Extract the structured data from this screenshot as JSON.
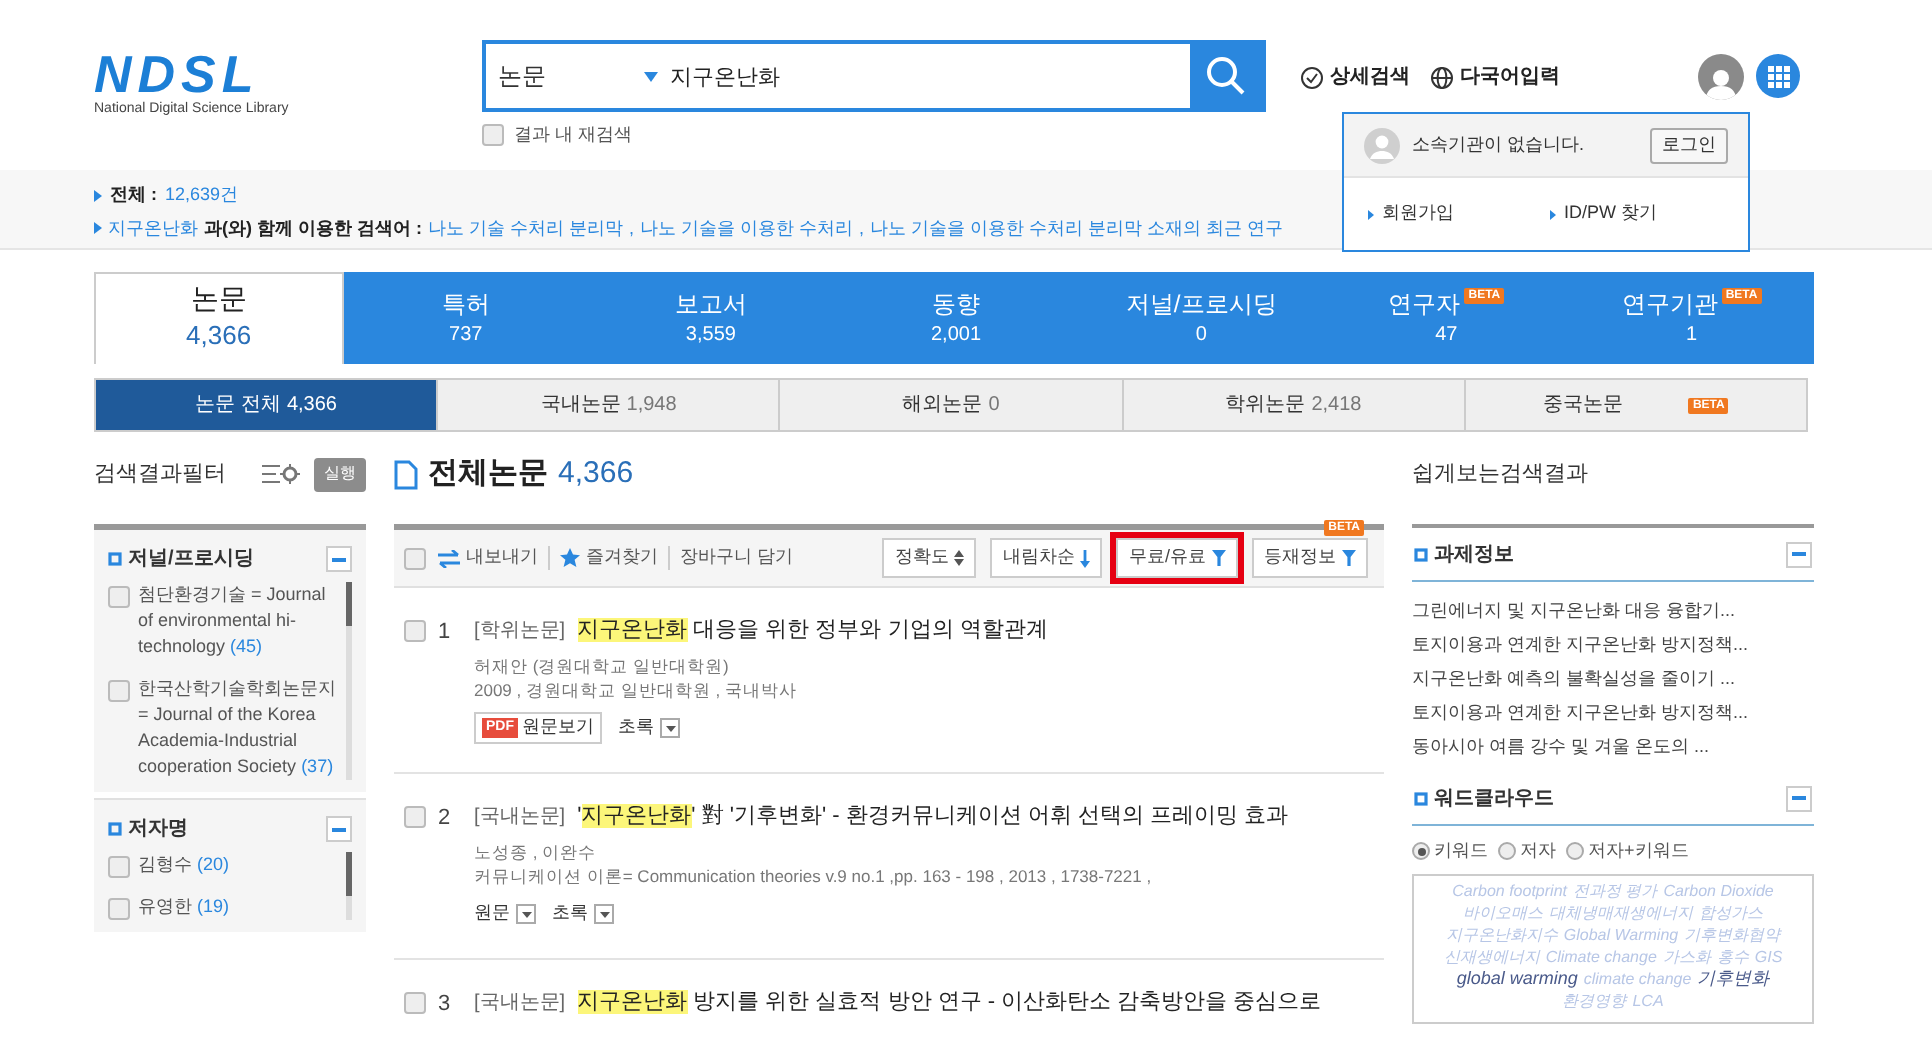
{
  "logo": {
    "mark": "NDSL",
    "subtitle": "National Digital Science Library"
  },
  "search": {
    "category": "논문",
    "value": "지구온난화",
    "refine": {
      "label": "결과 내 재검색",
      "checked": false
    }
  },
  "header_links": [
    {
      "label": "상세검색",
      "kind": "check"
    },
    {
      "label": "다국어입력",
      "kind": "globe"
    }
  ],
  "account_popup": {
    "message": "소속기관이 없습니다.",
    "login": "로그인",
    "links": [
      "회원가입",
      "ID/PW 찾기"
    ]
  },
  "summary": {
    "total_label": "전체 :",
    "total": "12,639건",
    "keyword": "지구온난화",
    "related_label": "과(와) 함께 이용한 검색어 :",
    "related": [
      {
        "text": "나노 기술 수처리 분리막",
        "separator": ","
      },
      {
        "text": "나노 기술을 이용한 수처리",
        "separator": ","
      },
      {
        "text": "나노 기술을 이용한 수처리 분리막 소재의 최근 연구"
      }
    ]
  },
  "tabs": [
    {
      "label": "논문",
      "count": "4,366",
      "selected": true
    },
    {
      "label": "특허",
      "count": "737",
      "selected": false
    },
    {
      "label": "보고서",
      "count": "3,559",
      "selected": false
    },
    {
      "label": "동향",
      "count": "2,001",
      "selected": false
    },
    {
      "label": "저널/프로시딩",
      "count": "0",
      "selected": false
    },
    {
      "label": "연구자",
      "count": "47",
      "selected": false,
      "badge": "BETA"
    },
    {
      "label": "연구기관",
      "count": "1",
      "selected": false,
      "badge": "BETA"
    }
  ],
  "subtabs": [
    {
      "label": "논문 전체",
      "count": "4,366",
      "selected": true
    },
    {
      "label": "국내논문",
      "count": "1,948",
      "selected": false
    },
    {
      "label": "해외논문",
      "count": "0",
      "selected": false
    },
    {
      "label": "학위논문",
      "count": "2,418",
      "selected": false
    },
    {
      "label": "중국논문",
      "selected": false,
      "badge": "BETA"
    }
  ],
  "filter": {
    "title": "검색결과필터",
    "run": "실행",
    "groups": [
      {
        "title": "저널/프로시딩",
        "items": [
          {
            "label": "첨단환경기술 = Journal of environmental hi-technology",
            "count": "(45)",
            "checked": false
          },
          {
            "label": "한국산학기술학회논문지 = Journal of the Korea Academia-Industrial cooperation Society",
            "count": "(37)",
            "checked": false
          }
        ]
      },
      {
        "title": "저자명",
        "items": [
          {
            "label": "김형수",
            "count": "(20)",
            "checked": false
          },
          {
            "label": "유영한",
            "count": "(19)",
            "checked": false
          }
        ]
      }
    ]
  },
  "results_header": {
    "title": "전체논문",
    "count": "4,366"
  },
  "toolbar": {
    "select_all_checked": false,
    "actions": [
      "내보내기",
      "즐겨찾기",
      "장바구니 담기"
    ],
    "sorts": [
      {
        "label": "정확도",
        "kind": "updown",
        "highlighted": false
      },
      {
        "label": "내림차순",
        "kind": "down",
        "highlighted": false
      },
      {
        "label": "무료/유료",
        "kind": "filter",
        "highlighted": true
      },
      {
        "label": "등재정보",
        "kind": "filter",
        "highlighted": false,
        "badge": "BETA"
      }
    ]
  },
  "results": [
    {
      "number": "1",
      "checked": false,
      "type": "[학위논문]",
      "title": {
        "highlight": "지구온난화",
        "after": " 대응을 위한 정부와 기업의 역할관계"
      },
      "meta": [
        "허재안 (경원대학교 일반대학원)",
        "2009 , 경원대학교 일반대학원 , 국내박사"
      ],
      "buttons": [
        {
          "label": "원문보기",
          "kind": "pdf",
          "badge": "PDF"
        },
        {
          "label": "초록",
          "kind": "toggle"
        }
      ]
    },
    {
      "number": "2",
      "checked": false,
      "type": "[국내논문]",
      "title": {
        "before": "'",
        "highlight": "지구온난화",
        "after": "' 對 '기후변화' - 환경커뮤니케이션 어휘 선택의 프레이밍 효과"
      },
      "meta": [
        "노성종 , 이완수",
        "커뮤니케이션 이론= Communication theories v.9 no.1 ,pp. 163 - 198 , 2013 , 1738-7221 ,"
      ],
      "buttons": [
        {
          "label": "원문",
          "kind": "toggle"
        },
        {
          "label": "초록",
          "kind": "toggle"
        }
      ]
    },
    {
      "number": "3",
      "checked": false,
      "type": "[국내논문]",
      "title": {
        "highlight": "지구온난화",
        "after": " 방지를 위한 실효적 방안 연구 - 이산화탄소 감축방안을 중심으로"
      }
    }
  ],
  "side": {
    "title": "쉽게보는검색결과",
    "projects": {
      "title": "과제정보",
      "items": [
        "그린에너지 및 지구온난화 대응 융합기...",
        "토지이용과 연계한 지구온난화 방지정책...",
        "지구온난화 예측의 불확실성을 줄이기 ...",
        "토지이용과 연계한 지구온난화 방지정책...",
        "동아시아 여름 강수 및 겨울 온도의 ..."
      ]
    },
    "cloud": {
      "title": "워드클라우드",
      "options": [
        {
          "label": "키워드",
          "selected": true
        },
        {
          "label": "저자",
          "selected": false
        },
        {
          "label": "저자+키워드",
          "selected": false
        }
      ],
      "words": [
        {
          "text": "Carbon footprint",
          "emphasis": false
        },
        {
          "text": "전과정 평가",
          "emphasis": false
        },
        {
          "text": "Carbon Dioxide",
          "emphasis": false
        },
        {
          "text": "바이오매스",
          "emphasis": false
        },
        {
          "text": "대체냉매재생에너지",
          "emphasis": false
        },
        {
          "text": "합성가스",
          "emphasis": false
        },
        {
          "text": "지구온난화지수",
          "emphasis": false
        },
        {
          "text": "Global Warming",
          "emphasis": false
        },
        {
          "text": "기후변화협약",
          "emphasis": false
        },
        {
          "text": "신재생에너지",
          "emphasis": false
        },
        {
          "text": "Climate change",
          "emphasis": false
        },
        {
          "text": "가스화",
          "emphasis": false
        },
        {
          "text": "홍수",
          "emphasis": false
        },
        {
          "text": "GIS",
          "emphasis": false
        },
        {
          "text": "global warming",
          "emphasis": true
        },
        {
          "text": "climate change",
          "emphasis": false
        },
        {
          "text": "기후변화",
          "emphasis": true
        },
        {
          "text": "환경영향",
          "emphasis": false
        },
        {
          "text": "LCA",
          "emphasis": false
        }
      ]
    }
  }
}
